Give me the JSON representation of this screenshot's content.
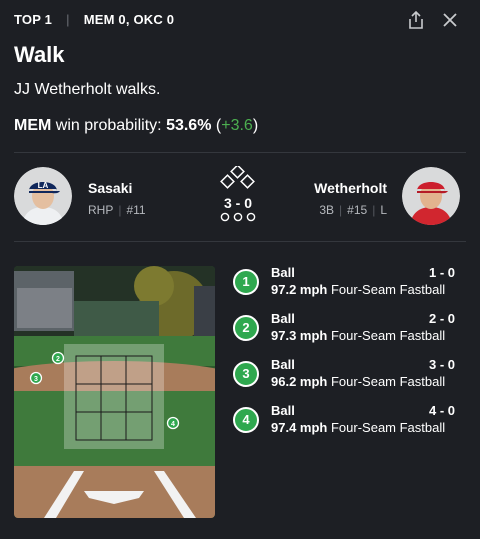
{
  "header": {
    "inning": "TOP 1",
    "score": "MEM 0, OKC 0"
  },
  "event": {
    "title": "Walk",
    "description": "JJ Wetherholt walks.",
    "team": "MEM",
    "wp_label": "win probability:",
    "wp_value": "53.6%",
    "wp_open": " (",
    "wp_change": "+3.6",
    "wp_close": ")"
  },
  "pitcher": {
    "name": "Sasaki",
    "role": "RHP",
    "number": "#11"
  },
  "batter": {
    "name": "Wetherholt",
    "position": "3B",
    "number": "#15",
    "hand": "L"
  },
  "count": {
    "balls_strikes": "3 - 0"
  },
  "pitches": [
    {
      "n": "1",
      "result": "Ball",
      "count": "1 - 0",
      "speed": "97.2 mph",
      "type": "Four-Seam Fastball"
    },
    {
      "n": "2",
      "result": "Ball",
      "count": "2 - 0",
      "speed": "97.3 mph",
      "type": "Four-Seam Fastball"
    },
    {
      "n": "3",
      "result": "Ball",
      "count": "3 - 0",
      "speed": "96.2 mph",
      "type": "Four-Seam Fastball"
    },
    {
      "n": "4",
      "result": "Ball",
      "count": "4 - 0",
      "speed": "97.4 mph",
      "type": "Four-Seam Fastball"
    }
  ],
  "field_markers": [
    "2",
    "3",
    "4"
  ],
  "colors": {
    "accent_green": "#4caf50",
    "marker_green": "#2fa84f",
    "background": "#1d1f24"
  },
  "icons": {
    "share": "share-icon",
    "close": "close-icon"
  }
}
